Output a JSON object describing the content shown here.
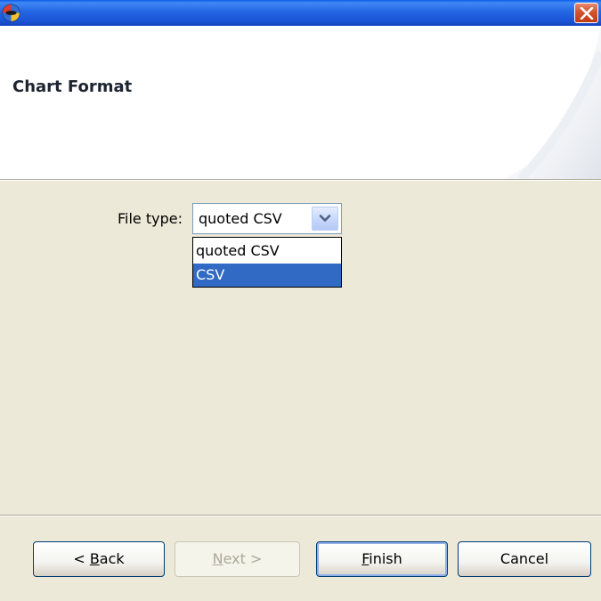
{
  "window": {
    "app_icon": "app-logo-icon",
    "close_icon": "close-icon",
    "colors": {
      "titlebar": "#2466e4",
      "close": "#d4532e",
      "face": "#ece9d8",
      "selection": "#316ac5"
    }
  },
  "header": {
    "title": "Chart Format"
  },
  "form": {
    "file_type_label": "File type:",
    "file_type_value": "quoted CSV",
    "arrow_icon": "chevron-down-icon",
    "options": [
      "quoted CSV",
      "CSV"
    ],
    "highlighted_option": "CSV"
  },
  "buttons": {
    "back": {
      "prefix": "< ",
      "mnemonic": "B",
      "rest": "ack"
    },
    "next": {
      "mnemonic": "N",
      "rest": "ext >",
      "enabled": false
    },
    "finish": {
      "mnemonic": "F",
      "rest": "inish",
      "default": true
    },
    "cancel": {
      "label": "Cancel"
    }
  }
}
